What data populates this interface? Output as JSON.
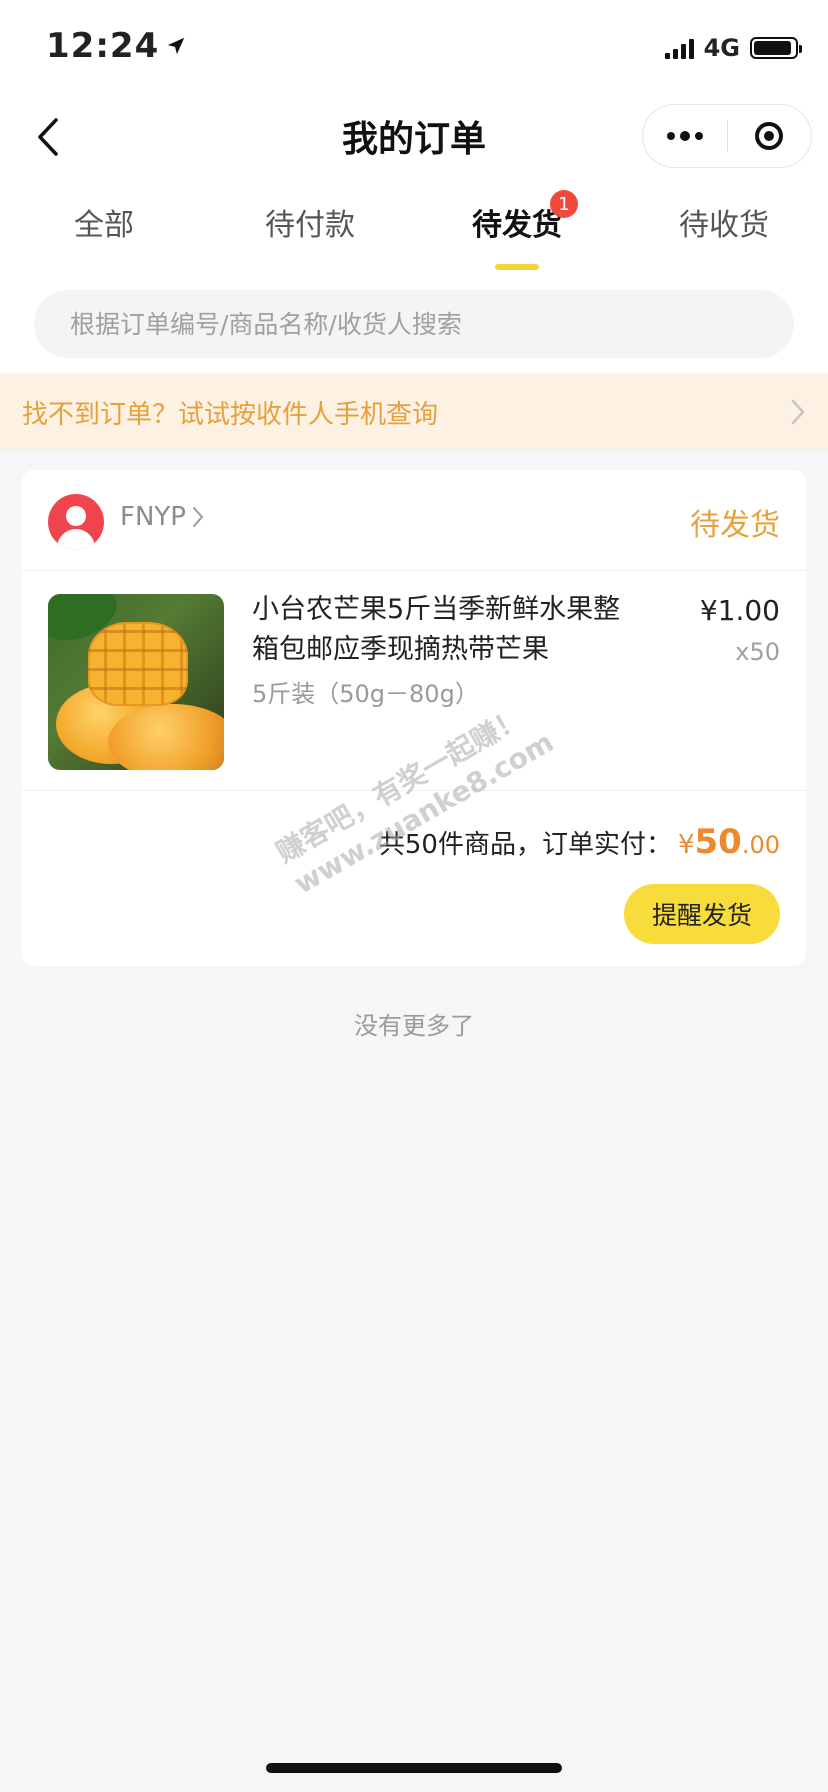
{
  "status_bar": {
    "time": "12:24",
    "network": "4G",
    "icons": [
      "location-arrow-icon",
      "signal-icon",
      "battery-icon"
    ]
  },
  "nav": {
    "title": "我的订单",
    "back_icon": "chevron-left-icon",
    "more_icon": "more-dots-icon",
    "close_icon": "target-circle-icon"
  },
  "tabs": [
    {
      "label": "全部",
      "active": false
    },
    {
      "label": "待付款",
      "active": false
    },
    {
      "label": "待发货",
      "active": true,
      "badge": "1"
    },
    {
      "label": "待收货",
      "active": false
    }
  ],
  "search": {
    "placeholder": "根据订单编号/商品名称/收货人搜索"
  },
  "notice": {
    "text": "找不到订单？试试按收件人手机查询",
    "chevron_icon": "chevron-right-icon"
  },
  "order": {
    "shop_name": "FNYP",
    "status": "待发货",
    "product": {
      "title": "小台农芒果5斤当季新鲜水果整箱包邮应季现摘热带芒果",
      "spec": "5斤装（50g－80g）",
      "price": "¥1.00",
      "quantity": "x50"
    },
    "summary_text": "共50件商品，订单实付：",
    "amount_symbol": "¥",
    "amount_int": "50",
    "amount_dec": ".00",
    "remind_button": "提醒发货"
  },
  "footer": {
    "no_more": "没有更多了"
  },
  "watermark": {
    "line1": "赚客吧，有奖一起赚！",
    "line2": "www.zuanke8.com"
  },
  "colors": {
    "accent_yellow": "#f8dc3c",
    "status_orange": "#e8a13a",
    "price_orange": "#ef8a2c",
    "badge_red": "#f04a3c",
    "notice_bg": "#fdf1e3"
  }
}
